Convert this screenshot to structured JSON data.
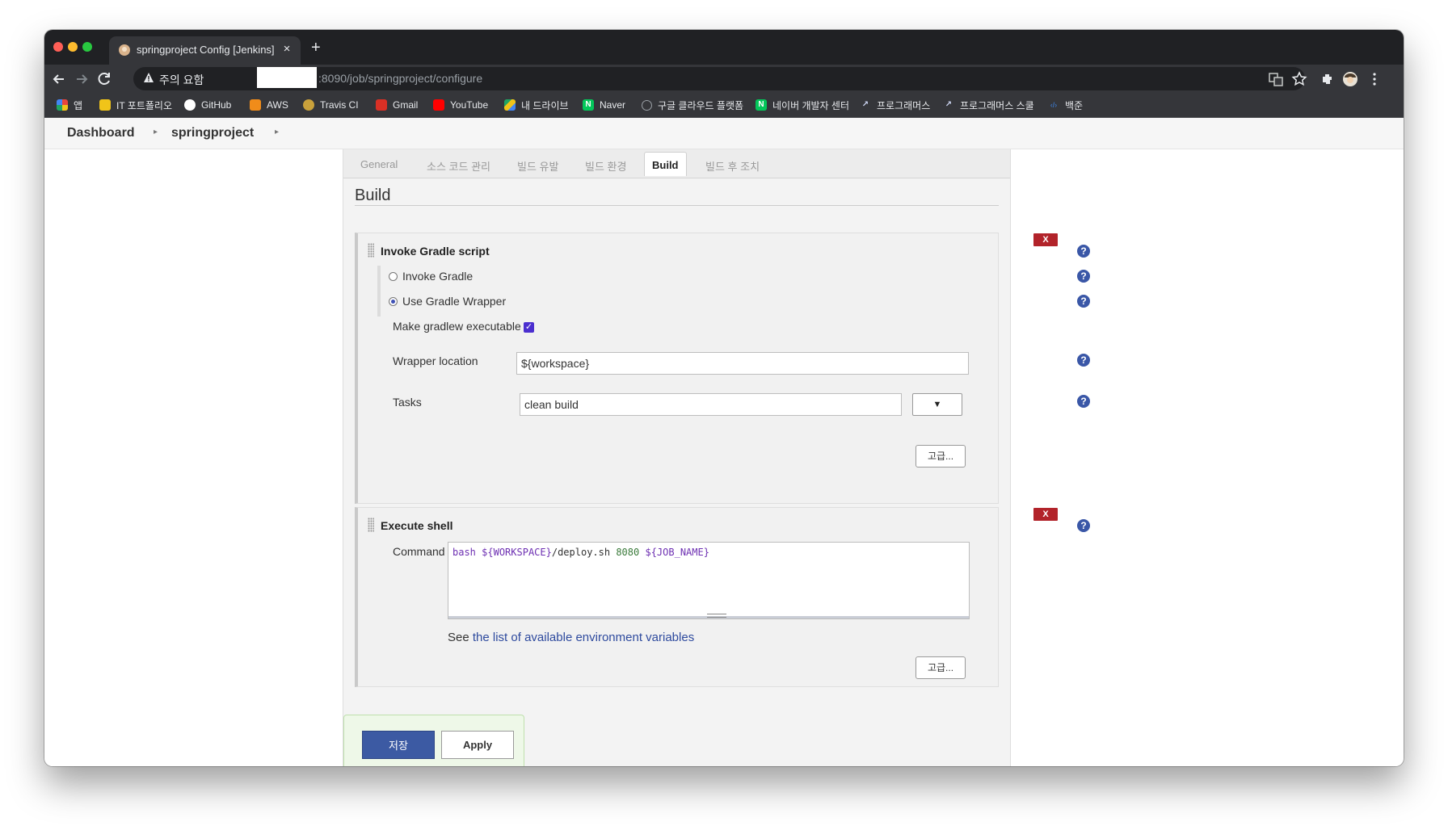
{
  "browser": {
    "tab_title": "springproject Config [Jenkins]",
    "new_tab": "+",
    "tab_close": "×",
    "security_label": "주의 요함",
    "url": ":8090/job/springproject/configure"
  },
  "bookmarks": [
    {
      "label": "앱",
      "icon": "apps-grid-icon",
      "color": "#e8453c"
    },
    {
      "label": "IT 포트폴리오",
      "icon": "portfolio-icon",
      "color": "#f0c419"
    },
    {
      "label": "GitHub",
      "icon": "github-icon",
      "color": "#ffffff"
    },
    {
      "label": "AWS",
      "icon": "aws-icon",
      "color": "#f08c1a"
    },
    {
      "label": "Travis CI",
      "icon": "travis-icon",
      "color": "#c9a13b"
    },
    {
      "label": "Gmail",
      "icon": "gmail-icon",
      "color": "#d93025"
    },
    {
      "label": "YouTube",
      "icon": "youtube-icon",
      "color": "#ff0000"
    },
    {
      "label": "내 드라이브",
      "icon": "drive-icon",
      "color": "#1fa463"
    },
    {
      "label": "Naver",
      "icon": "naver-icon",
      "color": "#03c75a"
    },
    {
      "label": "구글 클라우드 플랫폼",
      "icon": "gcp-icon",
      "color": "#9aa0a6"
    },
    {
      "label": "네이버 개발자 센터",
      "icon": "naver-dev-icon",
      "color": "#03c75a"
    },
    {
      "label": "프로그래머스",
      "icon": "programmers-icon",
      "color": "#cfd8f5"
    },
    {
      "label": "프로그래머스 스쿨",
      "icon": "programmers-school-icon",
      "color": "#cfd8f5"
    },
    {
      "label": "백준",
      "icon": "baekjoon-icon",
      "color": "#3b6fb6"
    }
  ],
  "breadcrumbs": [
    "Dashboard",
    "springproject"
  ],
  "config_tabs": [
    {
      "label": "General",
      "active": false
    },
    {
      "label": "소스 코드 관리",
      "active": false
    },
    {
      "label": "빌드 유발",
      "active": false
    },
    {
      "label": "빌드 환경",
      "active": false
    },
    {
      "label": "Build",
      "active": true
    },
    {
      "label": "빌드 후 조치",
      "active": false
    }
  ],
  "section_title": "Build",
  "gradle_step": {
    "title": "Invoke Gradle script",
    "delete_label": "X",
    "option_invoke": "Invoke Gradle",
    "option_wrapper": "Use Gradle Wrapper",
    "selected_option": "Use Gradle Wrapper",
    "make_executable_label": "Make gradlew executable",
    "make_executable_checked": true,
    "wrapper_location_label": "Wrapper location",
    "wrapper_location_value": "${workspace}",
    "tasks_label": "Tasks",
    "tasks_value": "clean build",
    "dropdown_symbol": "▼",
    "advanced_label": "고급..."
  },
  "shell_step": {
    "title": "Execute shell",
    "delete_label": "X",
    "command_label": "Command",
    "command_tokens": {
      "cmd": "bash",
      "workspace_var": "${WORKSPACE}",
      "path": "/deploy.sh",
      "port": "8080",
      "job_var": "${JOB_NAME}"
    },
    "env_prefix": "See",
    "env_link": "the list of available environment variables",
    "advanced_label": "고급..."
  },
  "help_symbol": "?",
  "buttons": {
    "save": "저장",
    "apply": "Apply"
  },
  "colors": {
    "save_button": "#3c5aa3",
    "delete_button": "#b2232a",
    "link": "#2e4a9e",
    "checkbox": "#4b2fcf"
  }
}
